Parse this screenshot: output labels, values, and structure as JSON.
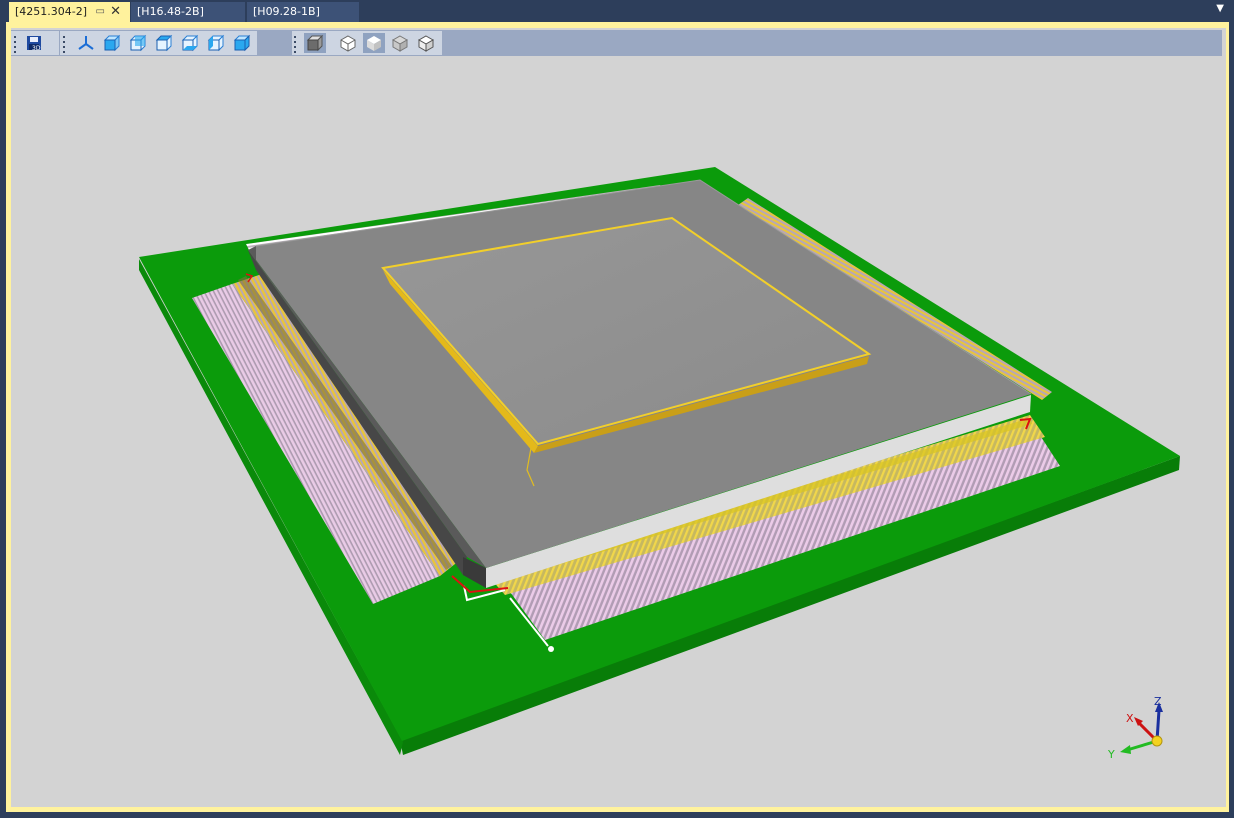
{
  "tabs": [
    {
      "label": "[4251.304-2]",
      "active": true
    },
    {
      "label": "[H16.48-2B]",
      "active": false
    },
    {
      "label": "[H09.28-1B]",
      "active": false
    }
  ],
  "toolbar": {
    "groups": [
      {
        "icons": [
          "save-3d-icon"
        ]
      },
      {
        "icons": [
          "axes-view-icon",
          "view-front-icon",
          "view-back-icon",
          "view-top-icon",
          "view-bottom-icon",
          "view-left-icon",
          "view-right-icon"
        ]
      },
      {
        "icons": [
          "view-3d-toggle-icon",
          "wireframe-icon",
          "shaded-icon",
          "hidden-lines-icon",
          "shaded-edges-icon"
        ]
      }
    ]
  },
  "axis_triad": {
    "x": "X",
    "y": "Y",
    "z": "Z"
  },
  "colors": {
    "accent": "#fff29d",
    "chrome": "#2d3e5b",
    "viewport_bg": "#d3d3d3",
    "board": "#0a9a0a",
    "package": "#858585",
    "lid": "#929292",
    "lead_gold": "#e8c53c",
    "pad_pink": "#e7c7e3",
    "axis_x": "#cc1111",
    "axis_y": "#22bb22",
    "axis_z": "#1a2f9e"
  }
}
